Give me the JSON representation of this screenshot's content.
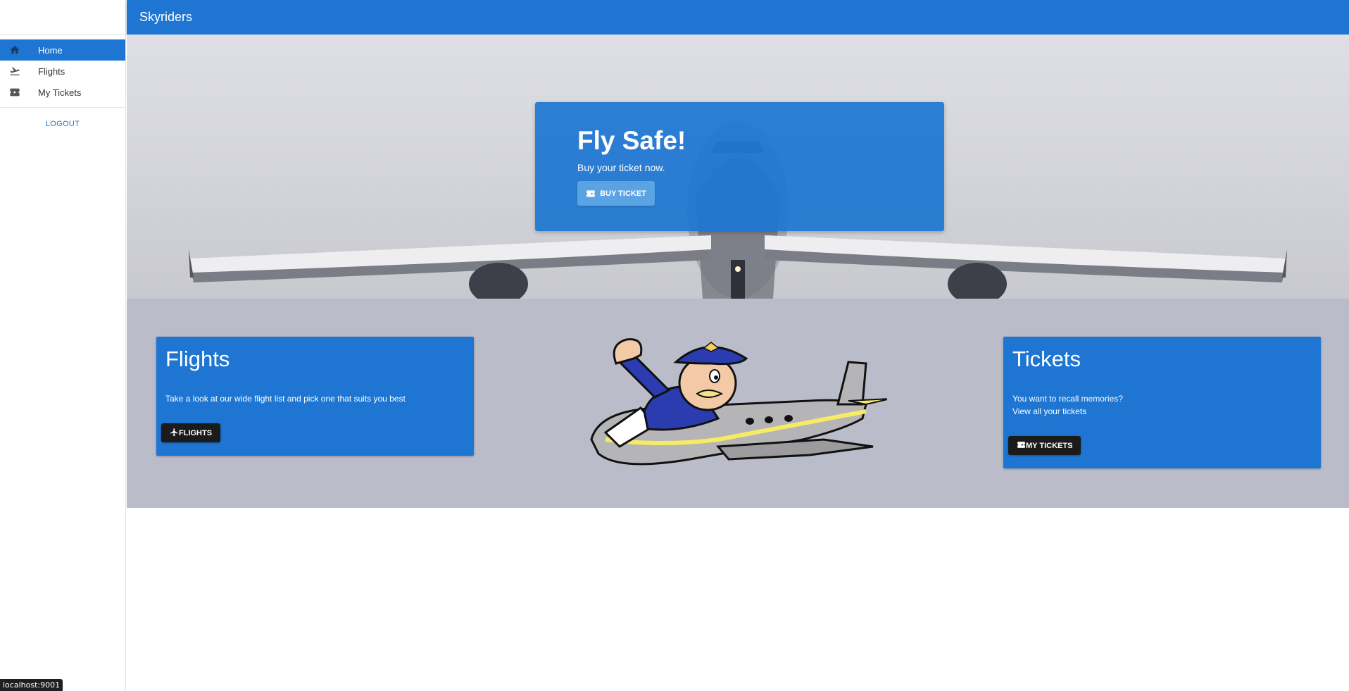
{
  "app": {
    "title": "Skyriders"
  },
  "sidebar": {
    "items": [
      {
        "label": "Home",
        "icon": "home-icon",
        "active": true
      },
      {
        "label": "Flights",
        "icon": "flight-takeoff-icon",
        "active": false
      },
      {
        "label": "My Tickets",
        "icon": "ticket-icon",
        "active": false
      }
    ],
    "logout_label": "LOGOUT"
  },
  "hero": {
    "heading": "Fly Safe!",
    "subtext": "Buy your ticket now.",
    "button_label": "BUY TICKET"
  },
  "cards": {
    "flights": {
      "title": "Flights",
      "text": "Take a look at our wide flight list and pick one that suits you best",
      "button_label": "FLIGHTS"
    },
    "tickets": {
      "title": "Tickets",
      "text_line1": "You want to recall memories?",
      "text_line2": "View all your tickets",
      "button_label": "MY TICKETS"
    }
  },
  "status_url": "localhost:9001",
  "colors": {
    "primary": "#1e76d2",
    "section_bg": "#babcc9",
    "dark_button": "#1b1b1b"
  }
}
